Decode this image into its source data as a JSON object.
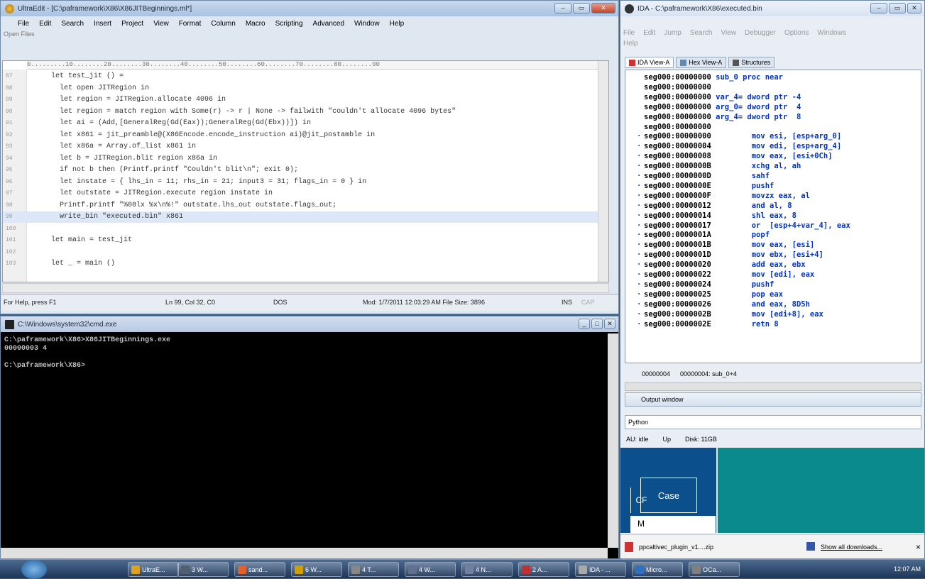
{
  "ultraedit": {
    "title": "UltraEdit - [C:\\paframework\\X86\\X86JITBeginnings.ml*]",
    "menu": [
      "File",
      "Edit",
      "Search",
      "Insert",
      "Project",
      "View",
      "Format",
      "Column",
      "Macro",
      "Scripting",
      "Advanced",
      "Window",
      "Help"
    ],
    "open_files": "Open Files",
    "ruler": "0.........10........20........30........40........50........60........70........80........90",
    "lines": [
      {
        "n": "87",
        "code": "let test_jit () ="
      },
      {
        "n": "88",
        "code": "  let open JITRegion in"
      },
      {
        "n": "89",
        "code": "  let region = JITRegion.allocate 4096 in"
      },
      {
        "n": "90",
        "code": "  let region = match region with Some(r) -> r | None -> failwith \"couldn't allocate 4096 bytes\""
      },
      {
        "n": "91",
        "code": "  let ai = (Add,[GeneralReg(Gd(Eax));GeneralReg(Gd(Ebx))]) in"
      },
      {
        "n": "92",
        "code": "  let x861 = jit_preamble@(X86Encode.encode_instruction ai)@jit_postamble in"
      },
      {
        "n": "93",
        "code": "  let x86a = Array.of_list x861 in"
      },
      {
        "n": "94",
        "code": "  let b = JITRegion.blit region x86a in"
      },
      {
        "n": "95",
        "code": "  if not b then (Printf.printf \"Couldn't blit\\n\"; exit 0);"
      },
      {
        "n": "96",
        "code": "  let instate = { lhs_in = 11; rhs_in = 21; input3 = 31; flags_in = 0 } in"
      },
      {
        "n": "97",
        "code": "  let outstate = JITRegion.execute region instate in"
      },
      {
        "n": "98",
        "code": "  Printf.printf \"%08lx %x\\n%!\" outstate.lhs_out outstate.flags_out;"
      },
      {
        "n": "99",
        "code": "  write_bin \"executed.bin\" x861"
      },
      {
        "n": "100",
        "code": ""
      },
      {
        "n": "101",
        "code": "let main = test_jit"
      },
      {
        "n": "102",
        "code": ""
      },
      {
        "n": "103",
        "code": "let _ = main ()"
      }
    ],
    "status": {
      "help": "For Help, press F1",
      "pos": "Ln 99, Col 32, C0",
      "format": "DOS",
      "mod": "Mod: 1/7/2011 12:03:29 AM  File Size: 3896",
      "ins": "INS",
      "cap": "CAP"
    }
  },
  "cmd": {
    "title": "C:\\Windows\\system32\\cmd.exe",
    "output": "C:\\paframework\\X86>X86JITBeginnings.exe\n00000003 4\n\nC:\\paframework\\X86>"
  },
  "ida": {
    "title": "IDA - C:\\paframework\\X86\\executed.bin",
    "menu": [
      "File",
      "Edit",
      "Jump",
      "Search",
      "View",
      "Debugger",
      "Options",
      "Windows",
      "Help"
    ],
    "tabs": [
      "IDA View-A",
      "Hex View-A",
      "Structures"
    ],
    "asm": [
      {
        "a": "seg000:00000000",
        "t": "sub_0 proc near",
        "dot": false
      },
      {
        "a": "seg000:00000000",
        "t": "",
        "dot": false
      },
      {
        "a": "seg000:00000000",
        "t": "var_4= dword ptr -4",
        "dot": false
      },
      {
        "a": "seg000:00000000",
        "t": "arg_0= dword ptr  4",
        "dot": false
      },
      {
        "a": "seg000:00000000",
        "t": "arg_4= dword ptr  8",
        "dot": false
      },
      {
        "a": "seg000:00000000",
        "t": "",
        "dot": false
      },
      {
        "a": "seg000:00000000",
        "t": "        mov esi, [esp+arg_0]",
        "dot": true
      },
      {
        "a": "seg000:00000004",
        "t": "        mov edi, [esp+arg_4]",
        "dot": true
      },
      {
        "a": "seg000:00000008",
        "t": "        mov eax, [esi+0Ch]",
        "dot": true
      },
      {
        "a": "seg000:0000000B",
        "t": "        xchg al, ah",
        "dot": true
      },
      {
        "a": "seg000:0000000D",
        "t": "        sahf",
        "dot": true
      },
      {
        "a": "seg000:0000000E",
        "t": "        pushf",
        "dot": true
      },
      {
        "a": "seg000:0000000F",
        "t": "        movzx eax, al",
        "dot": true
      },
      {
        "a": "seg000:00000012",
        "t": "        and al, 8",
        "dot": true
      },
      {
        "a": "seg000:00000014",
        "t": "        shl eax, 8",
        "dot": true
      },
      {
        "a": "seg000:00000017",
        "t": "        or  [esp+4+var_4], eax",
        "dot": true
      },
      {
        "a": "seg000:0000001A",
        "t": "        popf",
        "dot": true
      },
      {
        "a": "seg000:0000001B",
        "t": "        mov eax, [esi]",
        "dot": true
      },
      {
        "a": "seg000:0000001D",
        "t": "        mov ebx, [esi+4]",
        "dot": true
      },
      {
        "a": "seg000:00000020",
        "t": "        add eax, ebx",
        "dot": true
      },
      {
        "a": "seg000:00000022",
        "t": "        mov [edi], eax",
        "dot": true
      },
      {
        "a": "seg000:00000024",
        "t": "        pushf",
        "dot": true
      },
      {
        "a": "seg000:00000025",
        "t": "        pop eax",
        "dot": true
      },
      {
        "a": "seg000:00000026",
        "t": "        and eax, 8D5h",
        "dot": true
      },
      {
        "a": "seg000:0000002B",
        "t": "        mov [edi+8], eax",
        "dot": true
      },
      {
        "a": "seg000:0000002E",
        "t": "        retn 8",
        "dot": true
      }
    ],
    "status_left": "00000004",
    "status_right": "00000004: sub_0+4",
    "output_title": "Output window",
    "python": "Python",
    "au": "AU:  idle",
    "up": "Up",
    "disk": "Disk: 11GB",
    "case": "Case",
    "cf": "CF",
    "m": "M",
    "download_file": "ppcaltivec_plugin_v1....zip",
    "show_downloads": "Show all downloads...",
    "close": "×"
  },
  "taskbar": {
    "items": [
      "UltraE...",
      "3 W...",
      "sand...",
      "6 W...",
      "4 T...",
      "4 W...",
      "4 N...",
      "2 A...",
      "IDA - ...",
      "Micro...",
      "OCa..."
    ],
    "clock": "12:07 AM"
  }
}
